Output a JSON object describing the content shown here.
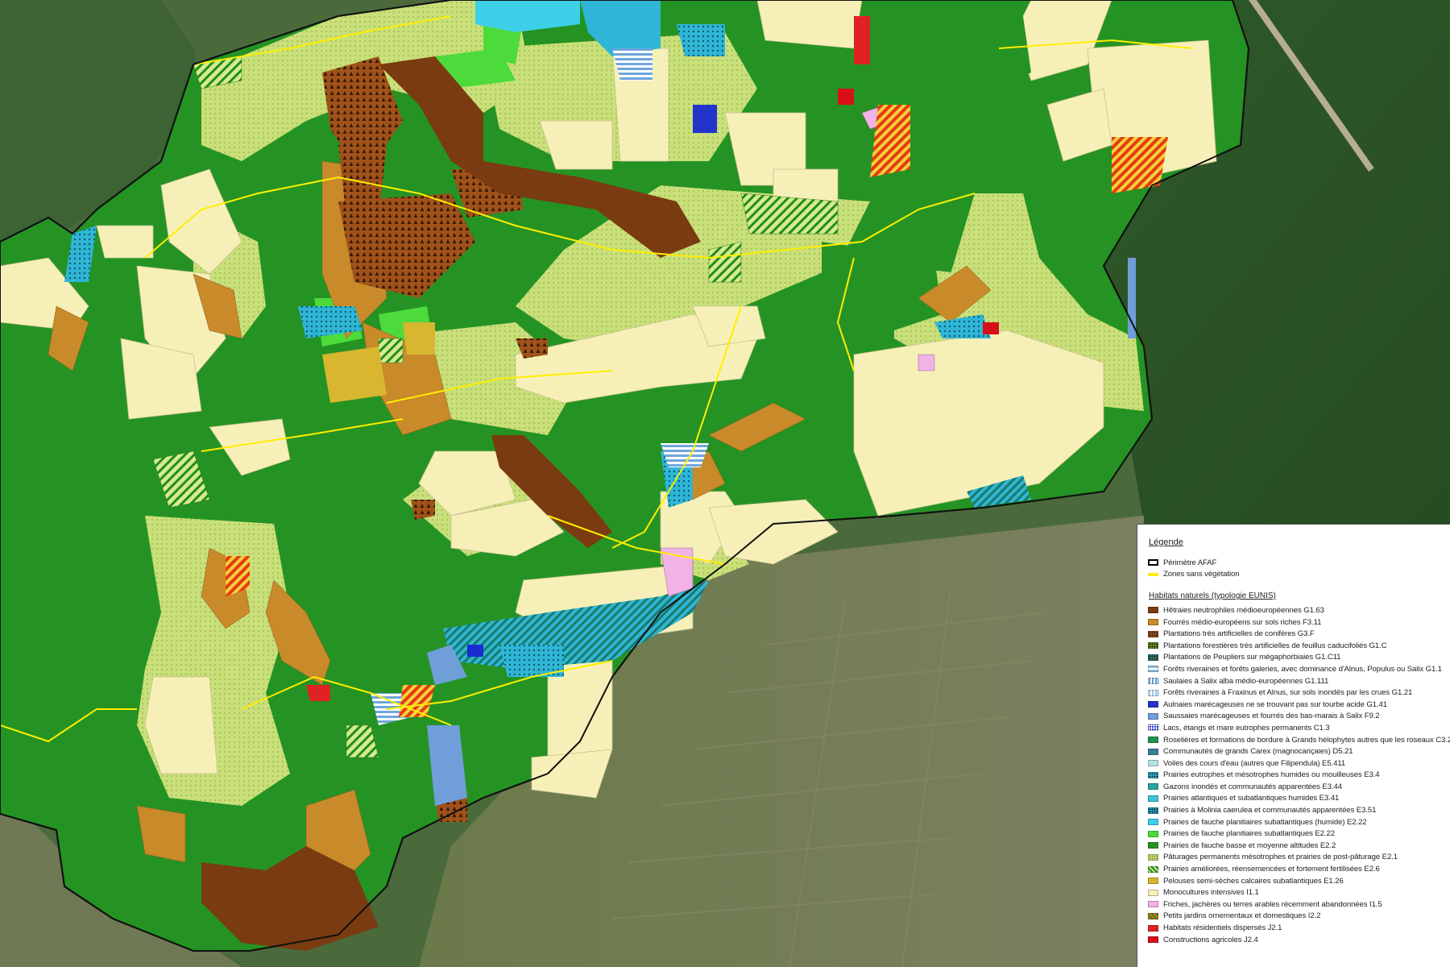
{
  "legend": {
    "title": "Légende",
    "general_items": [
      {
        "label": "Périmètre AFAF",
        "symbol": "perimeter-outline",
        "color": "#000000"
      },
      {
        "label": "Zones sans végétation",
        "symbol": "yellow-line",
        "color": "#ffee00"
      }
    ],
    "habitats_title": "Habitats naturels (typologie EUNIS)",
    "habitat_items": [
      {
        "label": "Hêtraies neutrophiles médioeuropéennes G1.63",
        "color": "#7a3b10",
        "pattern": "solid"
      },
      {
        "label": "Fourrés médio-européens sur sols riches F3.11",
        "color": "#c98a2a",
        "pattern": "solid"
      },
      {
        "label": "Plantations très artificielles de conifères G3.F",
        "color": "#a0521a",
        "pattern": "dots-dark"
      },
      {
        "label": "Plantations forestières très artificielles de feuillus caducifoliés G1.C",
        "color": "#6b8e23",
        "pattern": "dots-dark"
      },
      {
        "label": "Plantations de Peupliers sur mégaphorbiaies G1.C11",
        "color": "#2e7d6b",
        "pattern": "dots-dark"
      },
      {
        "label": "Forêts riveraines et forêts galeries, avec dominance d'Alnus, Populus ou Salix G1.1",
        "color": "#8fc1e3",
        "pattern": "h-lines"
      },
      {
        "label": "Saulaies à Salix alba médio-européennes G1.111",
        "color": "#5f9fd4",
        "pattern": "v-lines"
      },
      {
        "label": "Forêts riveraines à Fraxinus et Alnus, sur sols inondés par les crues G1.21",
        "color": "#9ec9ea",
        "pattern": "v-lines"
      },
      {
        "label": "Aulnaies marécageuses ne se trouvant pas sur tourbe acide G1.41",
        "color": "#2233cc",
        "pattern": "solid"
      },
      {
        "label": "Saussaies marécageuses et fourrés des bas-marais à Salix F9.2",
        "color": "#6f9ed8",
        "pattern": "solid"
      },
      {
        "label": "Lacs, étangs et mare eutrophes permanents C1.3",
        "color": "#1a2bd0",
        "pattern": "grid"
      },
      {
        "label": "Roselières et formations de bordure à Grands hélophytes autres que les roseaux C3.2",
        "color": "#1e9c7a",
        "pattern": "diag"
      },
      {
        "label": "Communautés de grands Carex (magnocariçaies) D5.21",
        "color": "#3a7f9a",
        "pattern": "solid"
      },
      {
        "label": "Voiles des cours d'eau (autres que Filipendula) E5.411",
        "color": "#b7dfe9",
        "pattern": "solid"
      },
      {
        "label": "Prairies eutrophes et mésotrophes humides ou mouilleuses E3.4",
        "color": "#2fb6d6",
        "pattern": "dots-dark"
      },
      {
        "label": "Gazons inondés et communautés apparentées E3.44",
        "color": "#26a3a3",
        "pattern": "solid"
      },
      {
        "label": "Prairies atlantiques et subatlantiques humides E3.41",
        "color": "#3dc3d6",
        "pattern": "solid"
      },
      {
        "label": "Prairies à Molinia caerulea et communautés apparentées E3.51",
        "color": "#1fa6c4",
        "pattern": "dots-dark"
      },
      {
        "label": "Prairies de fauche planitiaires subatlantiques (humide) E2.22",
        "color": "#3ecfe8",
        "pattern": "solid"
      },
      {
        "label": "Prairies de fauche planitiaires subatlantiques E2.22",
        "color": "#4cdb3a",
        "pattern": "solid"
      },
      {
        "label": "Prairies de fauche basse et moyenne altitudes E2.2",
        "color": "#259323",
        "pattern": "solid"
      },
      {
        "label": "Pâturages permanents mésotrophes et prairies de post-pâturage E2.1",
        "color": "#c9e07a",
        "pattern": "dots-light"
      },
      {
        "label": "Prairies améliorées, réensemencées et fortement fertilisées E2.6",
        "color": "#d4ec8a",
        "pattern": "diag"
      },
      {
        "label": "Pelouses semi-sèches calcaires subatlantiques E1.26",
        "color": "#d8b630",
        "pattern": "solid"
      },
      {
        "label": "Monocultures intensives I1.1",
        "color": "#f6f0b8",
        "pattern": "solid"
      },
      {
        "label": "Friches, jachères ou terres arables récemment abandonnées I1.5",
        "color": "#f1b2e6",
        "pattern": "solid"
      },
      {
        "label": "Petits jardins ornementaux et domestiques I2.2",
        "color": "#f06a1a",
        "pattern": "diag"
      },
      {
        "label": "Habitats résidentiels dispersés J2.1",
        "color": "#e02222",
        "pattern": "solid"
      },
      {
        "label": "Constructions agricoles J2.4",
        "color": "#d80f1a",
        "pattern": "solid"
      }
    ]
  }
}
